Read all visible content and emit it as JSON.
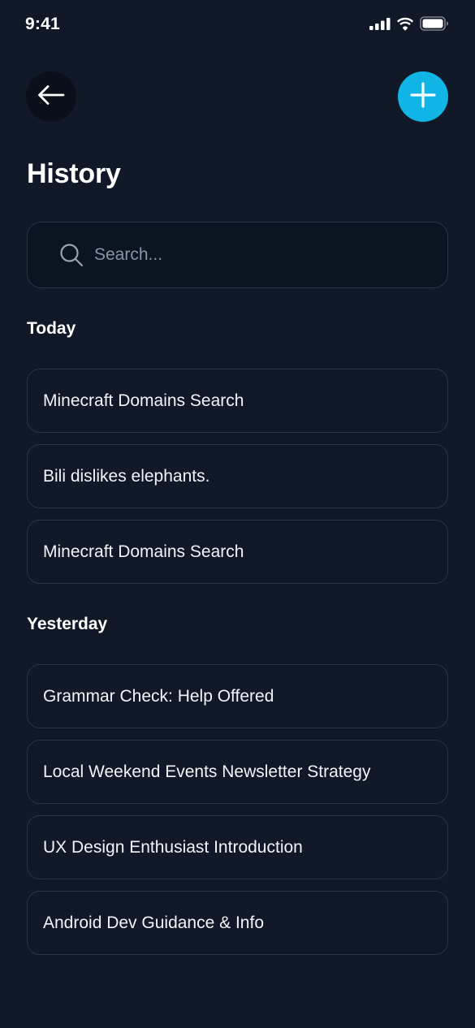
{
  "status_bar": {
    "time": "9:41"
  },
  "header": {
    "title": "History",
    "back_icon": "arrow-left-icon",
    "add_icon": "plus-icon"
  },
  "search": {
    "placeholder": "Search...",
    "value": ""
  },
  "sections": [
    {
      "title": "Today",
      "items": [
        "Minecraft Domains Search",
        "Bili dislikes elephants.",
        "Minecraft Domains Search"
      ]
    },
    {
      "title": "Yesterday",
      "items": [
        "Grammar Check: Help Offered",
        "Local Weekend Events Newsletter Strategy",
        "UX Design Enthusiast Introduction",
        "Android Dev Guidance & Info"
      ]
    }
  ],
  "colors": {
    "background": "#111828",
    "accent": "#10b5e6",
    "border": "#2a3447",
    "placeholder": "#8a93a3"
  }
}
